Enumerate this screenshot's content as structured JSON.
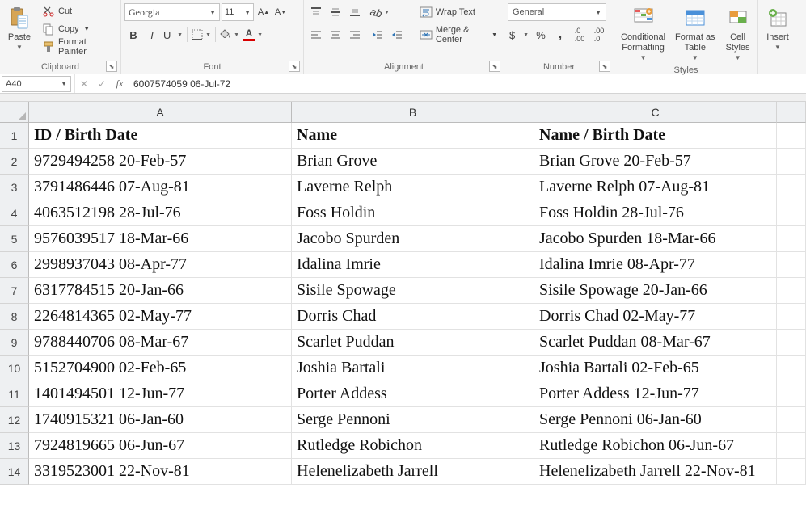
{
  "ribbon": {
    "clipboard": {
      "group_label": "Clipboard",
      "paste": "Paste",
      "cut": "Cut",
      "copy": "Copy",
      "format_painter": "Format Painter"
    },
    "font": {
      "group_label": "Font",
      "name": "Georgia",
      "size": "11",
      "fill_color": "#ffff00",
      "font_color": "#d80000"
    },
    "alignment": {
      "group_label": "Alignment",
      "wrap_text": "Wrap Text",
      "merge_center": "Merge & Center"
    },
    "number": {
      "group_label": "Number",
      "format": "General"
    },
    "styles": {
      "group_label": "Styles",
      "conditional": "Conditional\nFormatting",
      "format_as_table": "Format as\nTable",
      "cell_styles": "Cell\nStyles"
    },
    "cells": {
      "insert": "Insert"
    }
  },
  "formula_bar": {
    "name_box": "A40",
    "formula": "6007574059 06-Jul-72"
  },
  "grid": {
    "columns": [
      "A",
      "B",
      "C"
    ],
    "headers": {
      "A": "ID / Birth Date",
      "B": "Name",
      "C": "Name / Birth Date"
    },
    "rows": [
      {
        "n": 2,
        "A": "9729494258 20-Feb-57",
        "B": "Brian Grove",
        "C": "Brian Grove 20-Feb-57"
      },
      {
        "n": 3,
        "A": "3791486446 07-Aug-81",
        "B": "Laverne Relph",
        "C": "Laverne Relph 07-Aug-81"
      },
      {
        "n": 4,
        "A": "4063512198 28-Jul-76",
        "B": "Foss Holdin",
        "C": "Foss Holdin 28-Jul-76"
      },
      {
        "n": 5,
        "A": "9576039517 18-Mar-66",
        "B": "Jacobo Spurden",
        "C": "Jacobo Spurden 18-Mar-66"
      },
      {
        "n": 6,
        "A": "2998937043 08-Apr-77",
        "B": "Idalina Imrie",
        "C": "Idalina Imrie 08-Apr-77"
      },
      {
        "n": 7,
        "A": "6317784515 20-Jan-66",
        "B": "Sisile Spowage",
        "C": "Sisile Spowage 20-Jan-66"
      },
      {
        "n": 8,
        "A": "2264814365 02-May-77",
        "B": "Dorris Chad",
        "C": "Dorris Chad 02-May-77"
      },
      {
        "n": 9,
        "A": "9788440706 08-Mar-67",
        "B": "Scarlet Puddan",
        "C": "Scarlet Puddan 08-Mar-67"
      },
      {
        "n": 10,
        "A": "5152704900 02-Feb-65",
        "B": "Joshia Bartali",
        "C": "Joshia Bartali 02-Feb-65"
      },
      {
        "n": 11,
        "A": "1401494501 12-Jun-77",
        "B": "Porter Addess",
        "C": "Porter Addess 12-Jun-77"
      },
      {
        "n": 12,
        "A": "1740915321 06-Jan-60",
        "B": "Serge Pennoni",
        "C": "Serge Pennoni 06-Jan-60"
      },
      {
        "n": 13,
        "A": "7924819665 06-Jun-67",
        "B": "Rutledge Robichon",
        "C": "Rutledge Robichon 06-Jun-67"
      },
      {
        "n": 14,
        "A": "3319523001 22-Nov-81",
        "B": "Helenelizabeth Jarrell",
        "C": "Helenelizabeth Jarrell 22-Nov-81"
      }
    ]
  }
}
